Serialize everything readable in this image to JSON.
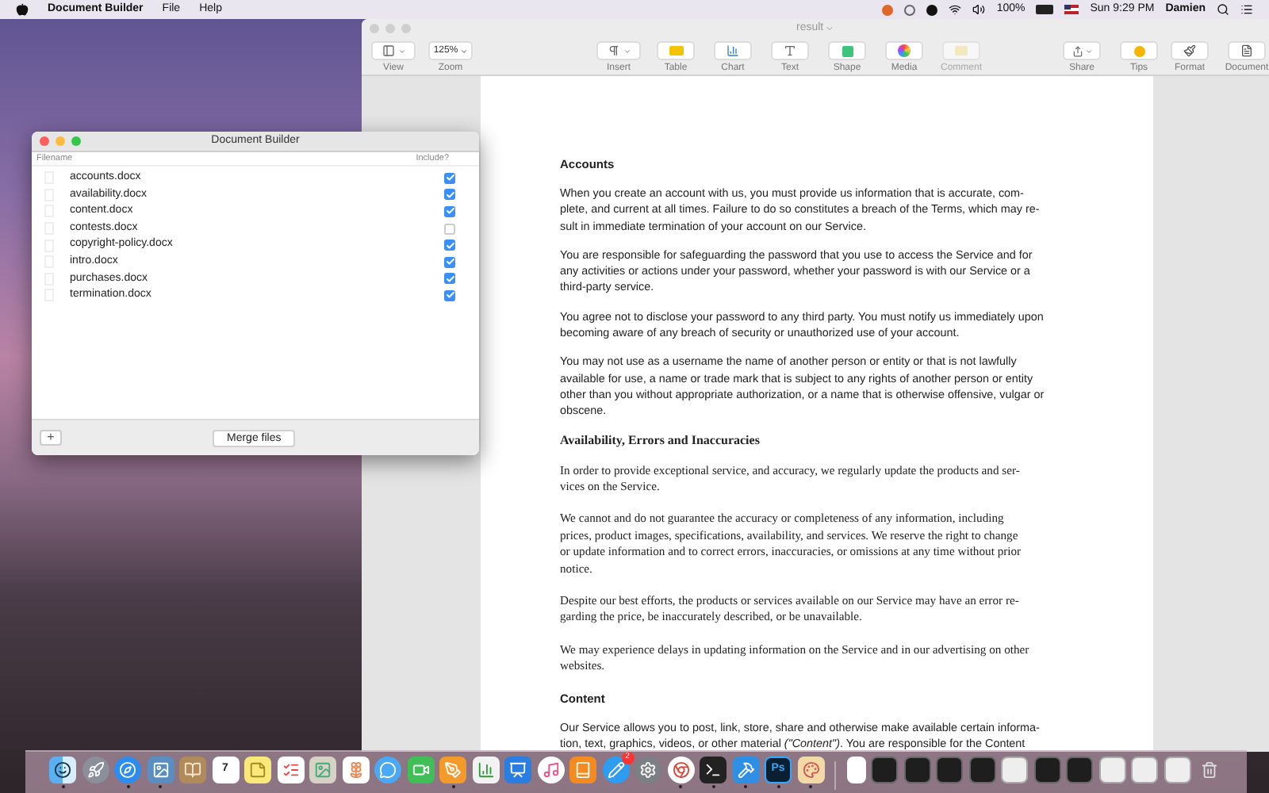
{
  "menu_bar": {
    "app_name": "Document Builder",
    "menus": [
      "File",
      "Help"
    ],
    "battery": "100%",
    "clock": "Sun 9:29 PM",
    "user": "Damien"
  },
  "pages_window": {
    "title": "result",
    "toolbar": {
      "left": [
        {
          "kind": "view",
          "label": "View",
          "disabled": false
        },
        {
          "kind": "zoom",
          "label": "Zoom",
          "value": "125%",
          "disabled": false
        }
      ],
      "center": [
        {
          "kind": "insert",
          "label": "Insert",
          "disabled": false
        },
        {
          "kind": "table",
          "label": "Table",
          "disabled": false
        },
        {
          "kind": "chart",
          "label": "Chart",
          "disabled": false
        },
        {
          "kind": "text",
          "label": "Text",
          "disabled": false
        },
        {
          "kind": "shape",
          "label": "Shape",
          "disabled": false
        },
        {
          "kind": "media",
          "label": "Media",
          "disabled": false
        },
        {
          "kind": "comment",
          "label": "Comment",
          "disabled": true
        }
      ],
      "share": [
        {
          "kind": "share",
          "label": "Share",
          "disabled": false
        },
        {
          "kind": "tips",
          "label": "Tips",
          "disabled": false
        }
      ],
      "right": [
        {
          "kind": "format",
          "label": "Format",
          "disabled": false
        },
        {
          "kind": "document",
          "label": "Document",
          "disabled": false
        }
      ]
    },
    "document": [
      {
        "kind": "sans-heading",
        "lines": [
          "Accounts"
        ]
      },
      {
        "kind": "sans-paragraph",
        "lines": [
          "When you create an account with us, you must provide us information that is accurate, com-",
          "plete, and current at all times. Failure to do so constitutes a breach of the Terms, which may re-",
          "sult in immediate termination of your account on our Service."
        ]
      },
      {
        "kind": "sans-paragraph",
        "lines": [
          "You are responsible for safeguarding the password that you use to access the Service and for",
          "any activities or actions under your password, whether your password is with our Service or a",
          "third-party service."
        ]
      },
      {
        "kind": "sans-paragraph",
        "lines": [
          "You agree not to disclose your password to any third party. You must notify us immediately upon",
          "becoming aware of any breach of security or unauthorized use of your account."
        ]
      },
      {
        "kind": "sans-paragraph",
        "lines": [
          "You may not use as a username the name of another person or entity or that is not lawfully",
          "available for use, a name or trade mark that is subject to any rights of another person or entity",
          "other than you without appropriate authorization, or a name that is otherwise offensive, vulgar or",
          "obscene."
        ]
      },
      {
        "kind": "serif-heading",
        "lines": [
          "Availability, Errors and Inaccuracies"
        ]
      },
      {
        "kind": "serif-paragraph",
        "lines": [
          "In order to provide exceptional service, and accuracy, we regularly update the products and ser-",
          "vices on the Service."
        ]
      },
      {
        "kind": "serif-paragraph",
        "lines": [
          "We cannot and do not guarantee the accuracy or completeness of any information, including",
          "prices, product images, specifications, availability, and services. We reserve the right to change",
          "or update information and to correct errors, inaccuracies, or omissions at any time without prior",
          "notice."
        ]
      },
      {
        "kind": "serif-paragraph",
        "lines": [
          "Despite our best efforts, the products or services available on our Service may have an error re-",
          "garding the price, be inaccurately described, or be unavailable."
        ]
      },
      {
        "kind": "serif-paragraph",
        "lines": [
          "We may experience delays in updating information on the Service and in our advertising on other",
          "websites."
        ]
      },
      {
        "kind": "sans-heading",
        "lines": [
          "Content"
        ]
      },
      {
        "kind": "sans-paragraph",
        "lines": [
          "Our Service allows you to post, link, store, share and otherwise make available certain informa-",
          "tion, text, graphics, videos, or other material *(\"Content\")*. You are responsible for the Content"
        ]
      }
    ]
  },
  "builder_window": {
    "title": "Document Builder",
    "columns": [
      "Filename",
      "Include?"
    ],
    "files": [
      {
        "name": "accounts.docx",
        "checked": true
      },
      {
        "name": "availability.docx",
        "checked": true
      },
      {
        "name": "content.docx",
        "checked": true
      },
      {
        "name": "contests.docx",
        "checked": false
      },
      {
        "name": "copyright-policy.docx",
        "checked": true
      },
      {
        "name": "intro.docx",
        "checked": true
      },
      {
        "name": "purchases.docx",
        "checked": true
      },
      {
        "name": "termination.docx",
        "checked": true
      }
    ],
    "add_button": "+",
    "merge_button": "Merge files"
  },
  "dock": [
    {
      "kind": "finder",
      "running": true
    },
    {
      "kind": "rocket",
      "running": false
    },
    {
      "kind": "compass",
      "running": true
    },
    {
      "kind": "photo",
      "running": true
    },
    {
      "kind": "contacts",
      "running": false
    },
    {
      "kind": "calendar",
      "label": "7",
      "running": false
    },
    {
      "kind": "notes",
      "running": false
    },
    {
      "kind": "list",
      "running": false
    },
    {
      "kind": "preview",
      "running": false
    },
    {
      "kind": "photos",
      "running": false
    },
    {
      "kind": "messages",
      "running": false
    },
    {
      "kind": "facetime",
      "running": false
    },
    {
      "kind": "pages",
      "running": true
    },
    {
      "kind": "numbers",
      "running": false
    },
    {
      "kind": "keynote",
      "running": false
    },
    {
      "kind": "music",
      "running": false
    },
    {
      "kind": "books",
      "running": false
    },
    {
      "kind": "store",
      "badge": "2",
      "running": false
    },
    {
      "kind": "settings",
      "running": false
    },
    {
      "kind": "chrome",
      "running": true
    },
    {
      "kind": "terminal",
      "running": true
    },
    {
      "kind": "xcode",
      "running": true
    },
    {
      "kind": "photoshop",
      "label": "Ps",
      "running": true
    },
    {
      "kind": "brushes",
      "running": true
    },
    {
      "kind": "separator"
    },
    {
      "kind": "document-window"
    },
    {
      "kind": "dark-window"
    },
    {
      "kind": "dark-window"
    },
    {
      "kind": "dark-window"
    },
    {
      "kind": "dark-window"
    },
    {
      "kind": "light-window"
    },
    {
      "kind": "dark-window"
    },
    {
      "kind": "dark-window"
    },
    {
      "kind": "light-window"
    },
    {
      "kind": "light-window"
    },
    {
      "kind": "light-window"
    },
    {
      "kind": "trash"
    }
  ]
}
